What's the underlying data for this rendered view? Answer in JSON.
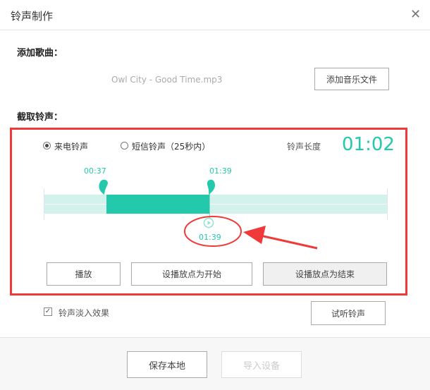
{
  "title": "铃声制作",
  "add_song": {
    "label": "添加歌曲：",
    "file_name": "Owl City - Good Time.mp3",
    "add_button": "添加音乐文件"
  },
  "clip": {
    "label": "截取铃声：",
    "radio_call": "来电铃声",
    "radio_sms": "短信铃声（25秒内）",
    "selected": "call",
    "length_label": "铃声长度",
    "length_value": "01:02",
    "start_time": "00:37",
    "end_time": "01:39",
    "playhead_time": "01:39",
    "buttons": {
      "play": "播放",
      "set_start": "设播放点为开始",
      "set_end": "设播放点为结束"
    }
  },
  "fade_in": {
    "label": "铃声淡入效果",
    "checked": true
  },
  "preview_button": "试听铃声",
  "footer": {
    "save": "保存本地",
    "import": "导入设备"
  },
  "colors": {
    "accent": "#24c8ab",
    "annotation": "#f03a3a"
  }
}
